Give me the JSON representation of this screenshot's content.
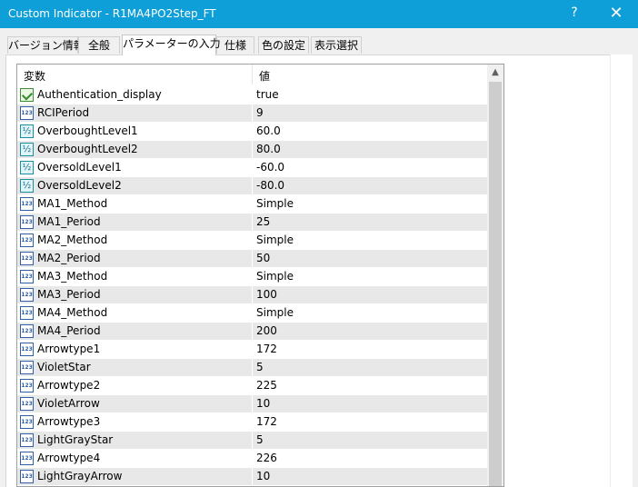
{
  "window": {
    "title": "Custom Indicator - R1MA4PO2Step_FT",
    "help": "?",
    "close": "✕"
  },
  "tabs": [
    {
      "label": "バージョン情報",
      "active": false
    },
    {
      "label": "全般",
      "active": false
    },
    {
      "label": "パラメーターの入力",
      "active": true
    },
    {
      "label": "仕様",
      "active": false
    },
    {
      "label": "色の設定",
      "active": false
    },
    {
      "label": "表示選択",
      "active": false
    }
  ],
  "grid": {
    "col_variable": "変数",
    "col_value": "値",
    "scroll_up": "▲",
    "rows": [
      {
        "name": "Authentication_display",
        "value": "true",
        "icon": "bool-icon"
      },
      {
        "name": "RCIPeriod",
        "value": "9",
        "icon": "int-icon"
      },
      {
        "name": "OverboughtLevel1",
        "value": "60.0",
        "icon": "double-icon"
      },
      {
        "name": "OverboughtLevel2",
        "value": "80.0",
        "icon": "double-icon"
      },
      {
        "name": "OversoldLevel1",
        "value": "-60.0",
        "icon": "double-icon"
      },
      {
        "name": "OversoldLevel2",
        "value": "-80.0",
        "icon": "double-icon"
      },
      {
        "name": "MA1_Method",
        "value": "Simple",
        "icon": "int-icon"
      },
      {
        "name": "MA1_Period",
        "value": "25",
        "icon": "int-icon"
      },
      {
        "name": "MA2_Method",
        "value": "Simple",
        "icon": "int-icon"
      },
      {
        "name": "MA2_Period",
        "value": "50",
        "icon": "int-icon"
      },
      {
        "name": "MA3_Method",
        "value": "Simple",
        "icon": "int-icon"
      },
      {
        "name": "MA3_Period",
        "value": "100",
        "icon": "int-icon"
      },
      {
        "name": "MA4_Method",
        "value": "Simple",
        "icon": "int-icon"
      },
      {
        "name": "MA4_Period",
        "value": "200",
        "icon": "int-icon"
      },
      {
        "name": "Arrowtype1",
        "value": "172",
        "icon": "int-icon"
      },
      {
        "name": "VioletStar",
        "value": "5",
        "icon": "int-icon"
      },
      {
        "name": "Arrowtype2",
        "value": "225",
        "icon": "int-icon"
      },
      {
        "name": "VioletArrow",
        "value": "10",
        "icon": "int-icon"
      },
      {
        "name": "Arrowtype3",
        "value": "172",
        "icon": "int-icon"
      },
      {
        "name": "LightGrayStar",
        "value": "5",
        "icon": "int-icon"
      },
      {
        "name": "Arrowtype4",
        "value": "226",
        "icon": "int-icon"
      },
      {
        "name": "LightGrayArrow",
        "value": "10",
        "icon": "int-icon"
      }
    ]
  },
  "colors": {
    "titlebar": "#0f9fd8",
    "row_alt": "#e8e8e8"
  }
}
